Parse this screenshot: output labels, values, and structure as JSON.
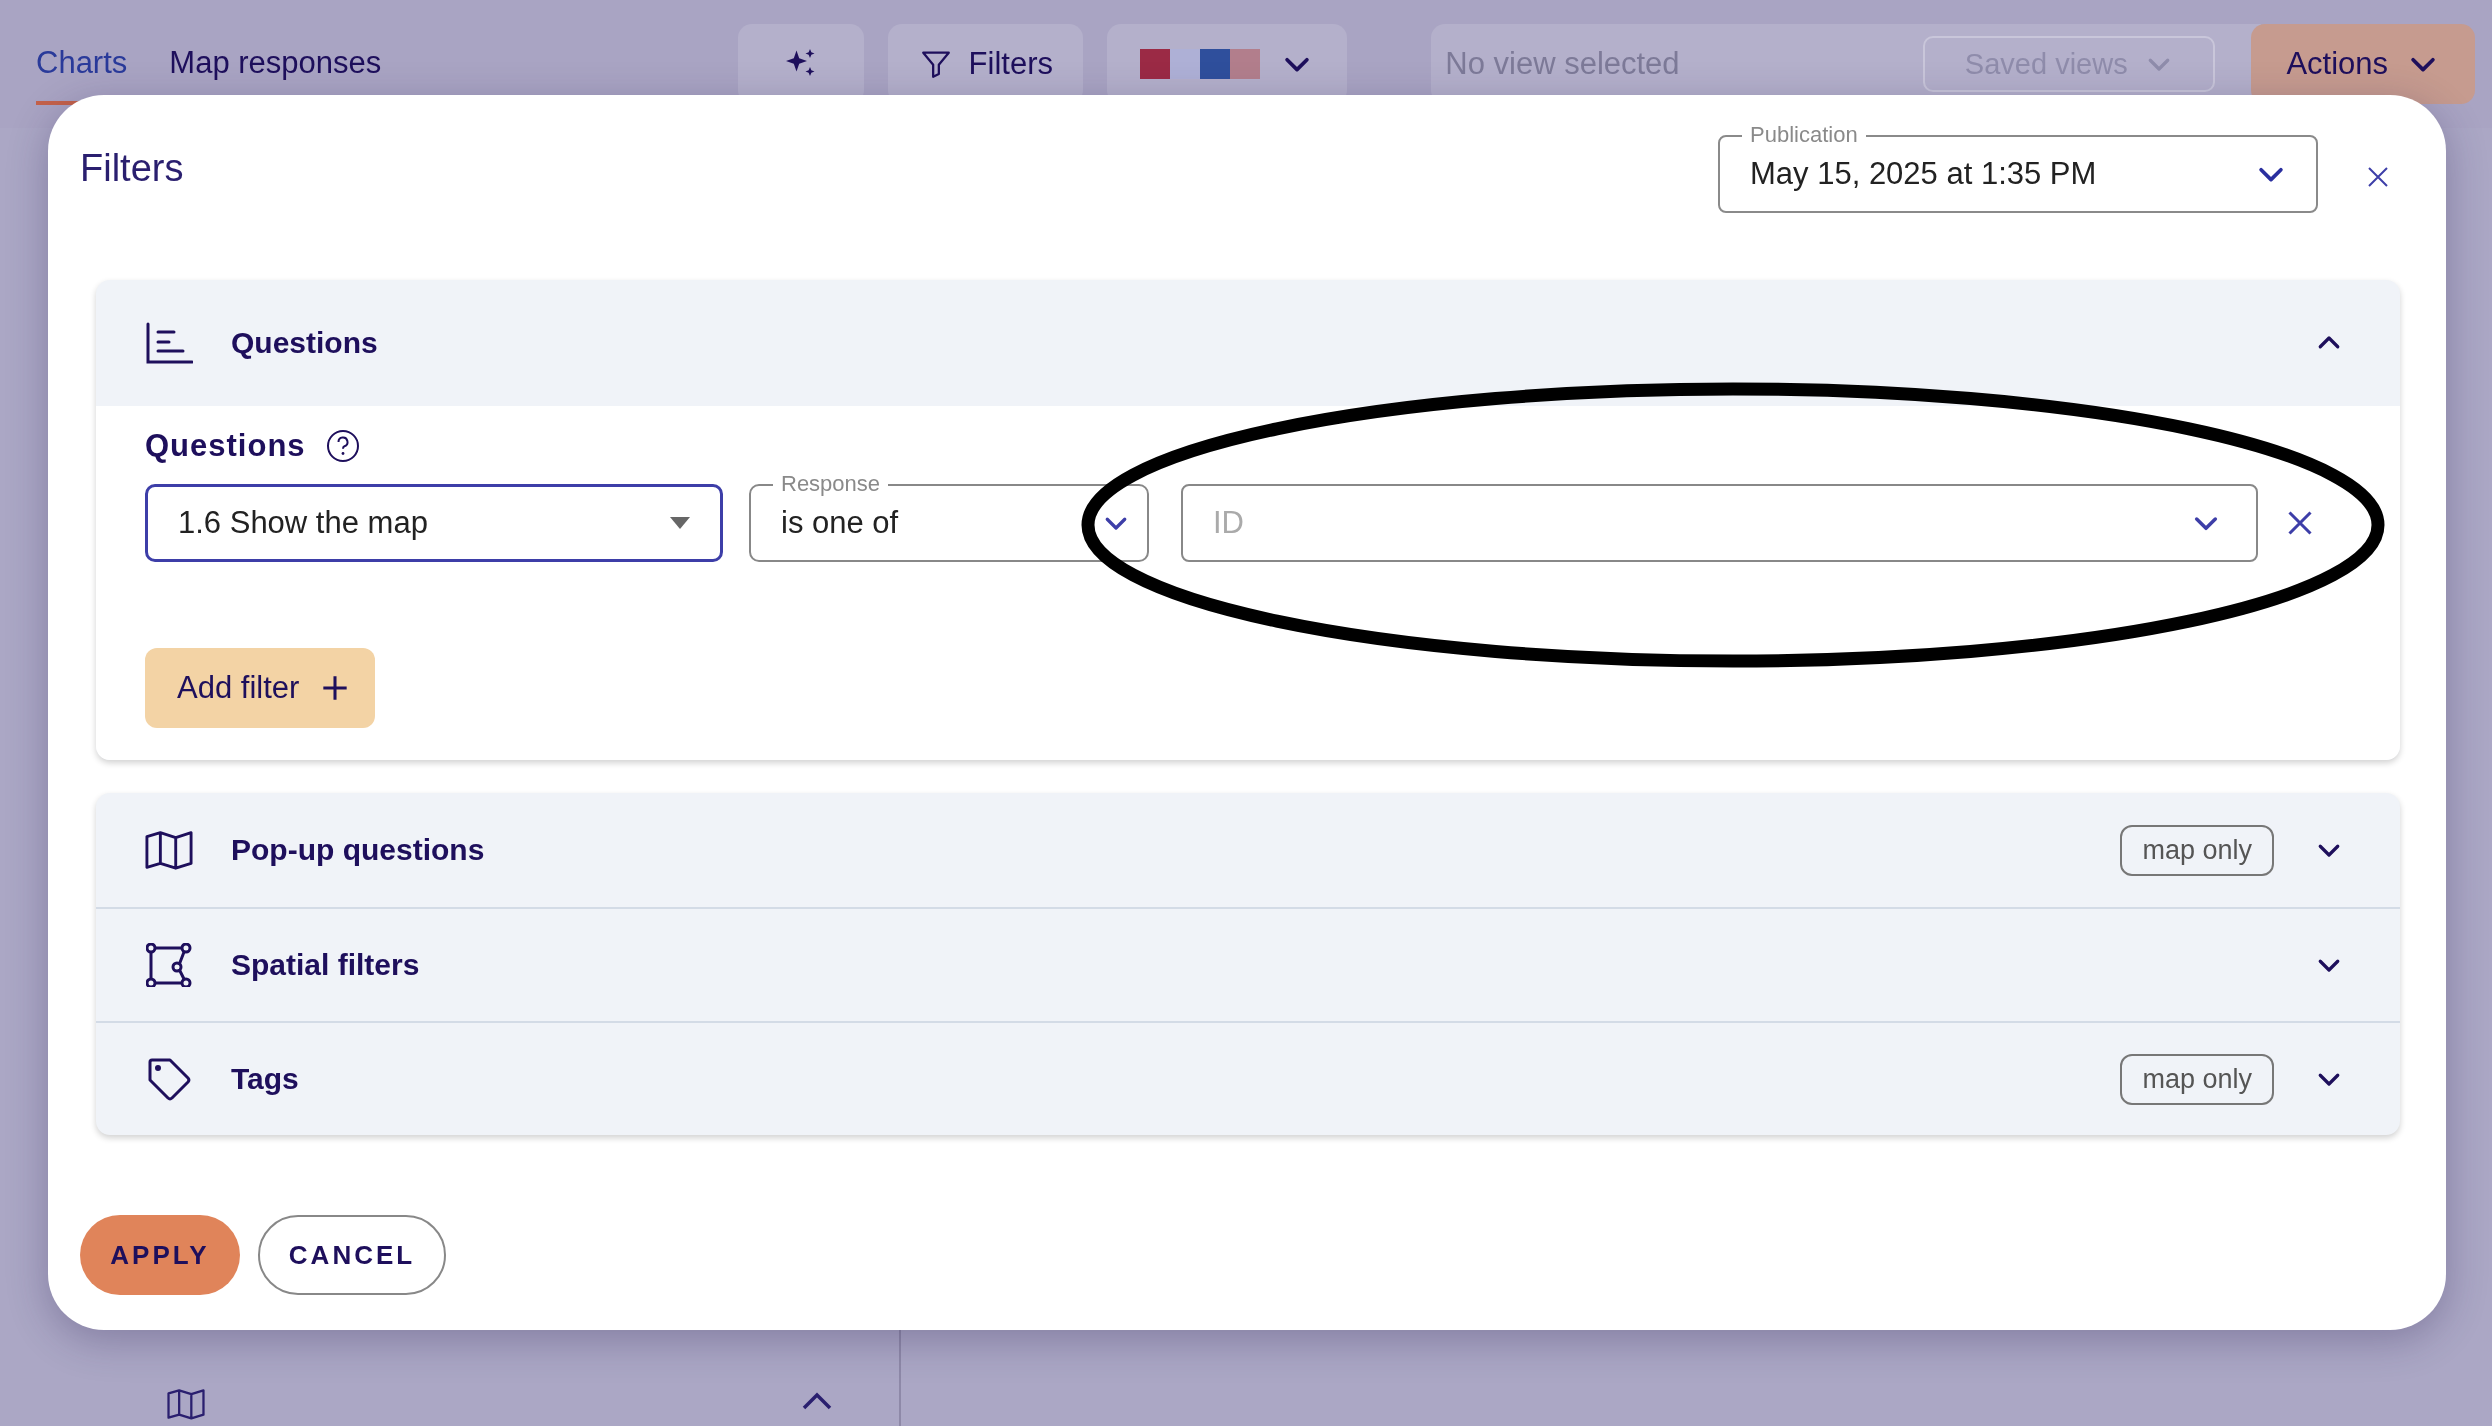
{
  "top_bar": {
    "tabs": [
      {
        "label": "Charts",
        "selected": true
      },
      {
        "label": "Map responses",
        "selected": false
      }
    ],
    "filters_button": "Filters",
    "palette": [
      {
        "color": "#9b2a45"
      },
      {
        "color": "#aeb0d6"
      },
      {
        "color": "#2f4f9c"
      },
      {
        "color": "#b27e8c"
      }
    ],
    "view_select": {
      "placeholder": "No view selected"
    },
    "saved_views_button": "Saved views",
    "actions_button": "Actions"
  },
  "dialog": {
    "title": "Filters",
    "publication": {
      "label": "Publication",
      "value": "May 15, 2025 at 1:35 PM"
    },
    "sections": [
      {
        "title": "Questions",
        "expanded": true
      },
      {
        "title": "Pop-up questions",
        "expanded": false,
        "badge": "map only"
      },
      {
        "title": "Spatial filters",
        "expanded": false
      },
      {
        "title": "Tags",
        "expanded": false,
        "badge": "map only"
      }
    ],
    "questions_body": {
      "label": "Questions",
      "filters": [
        {
          "question": "1.6 Show the map",
          "operator_label": "Response",
          "operator": "is one of",
          "value_placeholder": "ID"
        }
      ],
      "add_filter_button": "Add filter"
    },
    "apply_button": "APPLY",
    "cancel_button": "CANCEL"
  },
  "annotations": [
    {
      "kind": "ellipse"
    }
  ]
}
